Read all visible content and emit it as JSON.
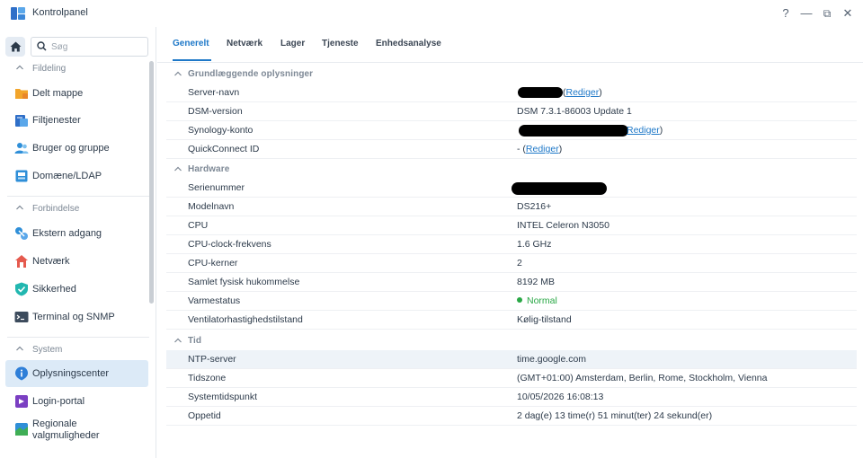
{
  "window": {
    "title": "Kontrolpanel",
    "controls": {
      "help": "?",
      "minimize": "—",
      "restore": "⧉",
      "close": "✕"
    }
  },
  "search": {
    "placeholder": "Søg",
    "value": ""
  },
  "sidebar": {
    "sections": [
      {
        "label": "Fildeling",
        "items": [
          {
            "label": "Delt mappe",
            "icon": "shared-folder-icon"
          },
          {
            "label": "Filtjenester",
            "icon": "file-services-icon"
          },
          {
            "label": "Bruger og gruppe",
            "icon": "users-icon"
          },
          {
            "label": "Domæne/LDAP",
            "icon": "domain-icon"
          }
        ]
      },
      {
        "label": "Forbindelse",
        "items": [
          {
            "label": "Ekstern adgang",
            "icon": "external-access-icon"
          },
          {
            "label": "Netværk",
            "icon": "network-icon"
          },
          {
            "label": "Sikkerhed",
            "icon": "security-shield-icon"
          },
          {
            "label": "Terminal og SNMP",
            "icon": "terminal-icon"
          }
        ]
      },
      {
        "label": "System",
        "items": [
          {
            "label": "Oplysningscenter",
            "icon": "info-icon",
            "active": true
          },
          {
            "label": "Login-portal",
            "icon": "login-portal-icon"
          },
          {
            "label": "Regionale valgmuligheder",
            "icon": "regional-icon"
          }
        ]
      }
    ]
  },
  "tabs": [
    "Generelt",
    "Netværk",
    "Lager",
    "Tjeneste",
    "Enhedsanalyse"
  ],
  "active_tab": "Generelt",
  "groups": [
    {
      "title": "Grundlæggende oplysninger",
      "rows": [
        {
          "key": "Server-navn",
          "value": "",
          "link": "Rediger",
          "suffix": ")",
          "redacted": true
        },
        {
          "key": "DSM-version",
          "value": "DSM 7.3.1-86003 Update 1"
        },
        {
          "key": "Synology-konto",
          "value": "",
          "link": "Rediger",
          "suffix": ")",
          "redacted": true
        },
        {
          "key": "QuickConnect ID",
          "value": "- (",
          "link": "Rediger",
          "suffix": ")"
        }
      ]
    },
    {
      "title": "Hardware",
      "rows": [
        {
          "key": "Serienummer",
          "value": "",
          "redacted": true
        },
        {
          "key": "Modelnavn",
          "value": "DS216+"
        },
        {
          "key": "CPU",
          "value": "INTEL Celeron N3050"
        },
        {
          "key": "CPU-clock-frekvens",
          "value": "1.6 GHz"
        },
        {
          "key": "CPU-kerner",
          "value": "2"
        },
        {
          "key": "Samlet fysisk hukommelse",
          "value": "8192 MB"
        },
        {
          "key": "Varmestatus",
          "value": "Normal",
          "status": "ok"
        },
        {
          "key": "Ventilatorhastighedstilstand",
          "value": "Kølig-tilstand"
        }
      ]
    },
    {
      "title": "Tid",
      "rows": [
        {
          "key": "NTP-server",
          "value": "time.google.com"
        },
        {
          "key": "Tidszone",
          "value": "(GMT+01:00) Amsterdam, Berlin, Rome, Stockholm, Vienna"
        },
        {
          "key": "Systemtidspunkt",
          "value": "10/05/2026 16:08:13"
        },
        {
          "key": "Oppetid",
          "value": "2 dag(e) 13 time(r) 51 minut(ter) 24 sekund(er)"
        }
      ]
    }
  ],
  "colors": {
    "accent": "#1e78c8",
    "status_ok": "#2aa846",
    "active_bg": "#dceaf7"
  }
}
